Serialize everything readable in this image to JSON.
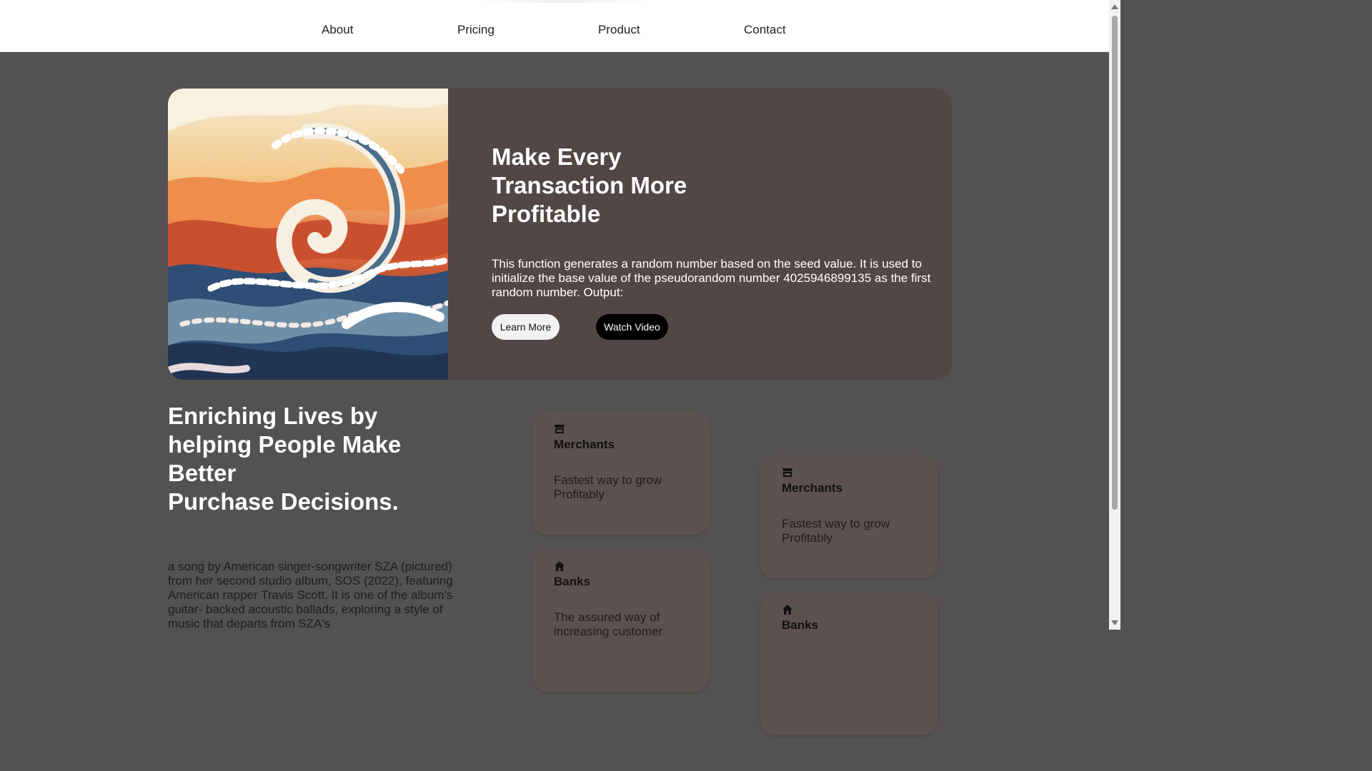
{
  "nav": {
    "items": [
      {
        "label": "About"
      },
      {
        "label": "Pricing"
      },
      {
        "label": "Product"
      },
      {
        "label": "Contact"
      }
    ]
  },
  "hero": {
    "title": "Make Every Transaction More Profitable",
    "description": "This function generates a random number based on the seed value. It is used to initialize the base value of the pseudorandom number 4025946899135 as the first random number. Output:",
    "learn_more_label": "Learn More",
    "watch_video_label": "Watch Video"
  },
  "section": {
    "title_line1": "Enriching Lives by helping People Make Better",
    "title_line2": "Purchase Decisions.",
    "body": "a song by American singer-songwriter SZA (pictured) from her second studio album, SOS (2022), featuring American rapper Travis Scott. It is one of the album's guitar- backed acoustic ballads, exploring a style of music that departs from SZA's"
  },
  "cards": [
    {
      "icon": "store-icon",
      "title": "Merchants",
      "text": "Fastest way to grow Profitably"
    },
    {
      "icon": "home-icon",
      "title": "Banks",
      "text": "The assured way of increasing customer"
    },
    {
      "icon": "store-icon",
      "title": "Merchants",
      "text": "Fastest way to grow Profitably"
    },
    {
      "icon": "home-icon",
      "title": "Banks",
      "text": ""
    }
  ],
  "colors": {
    "page_background": "#545152",
    "hero_card": "#534646",
    "feature_card": "#5d5150",
    "nav_background": "#ffffff"
  }
}
